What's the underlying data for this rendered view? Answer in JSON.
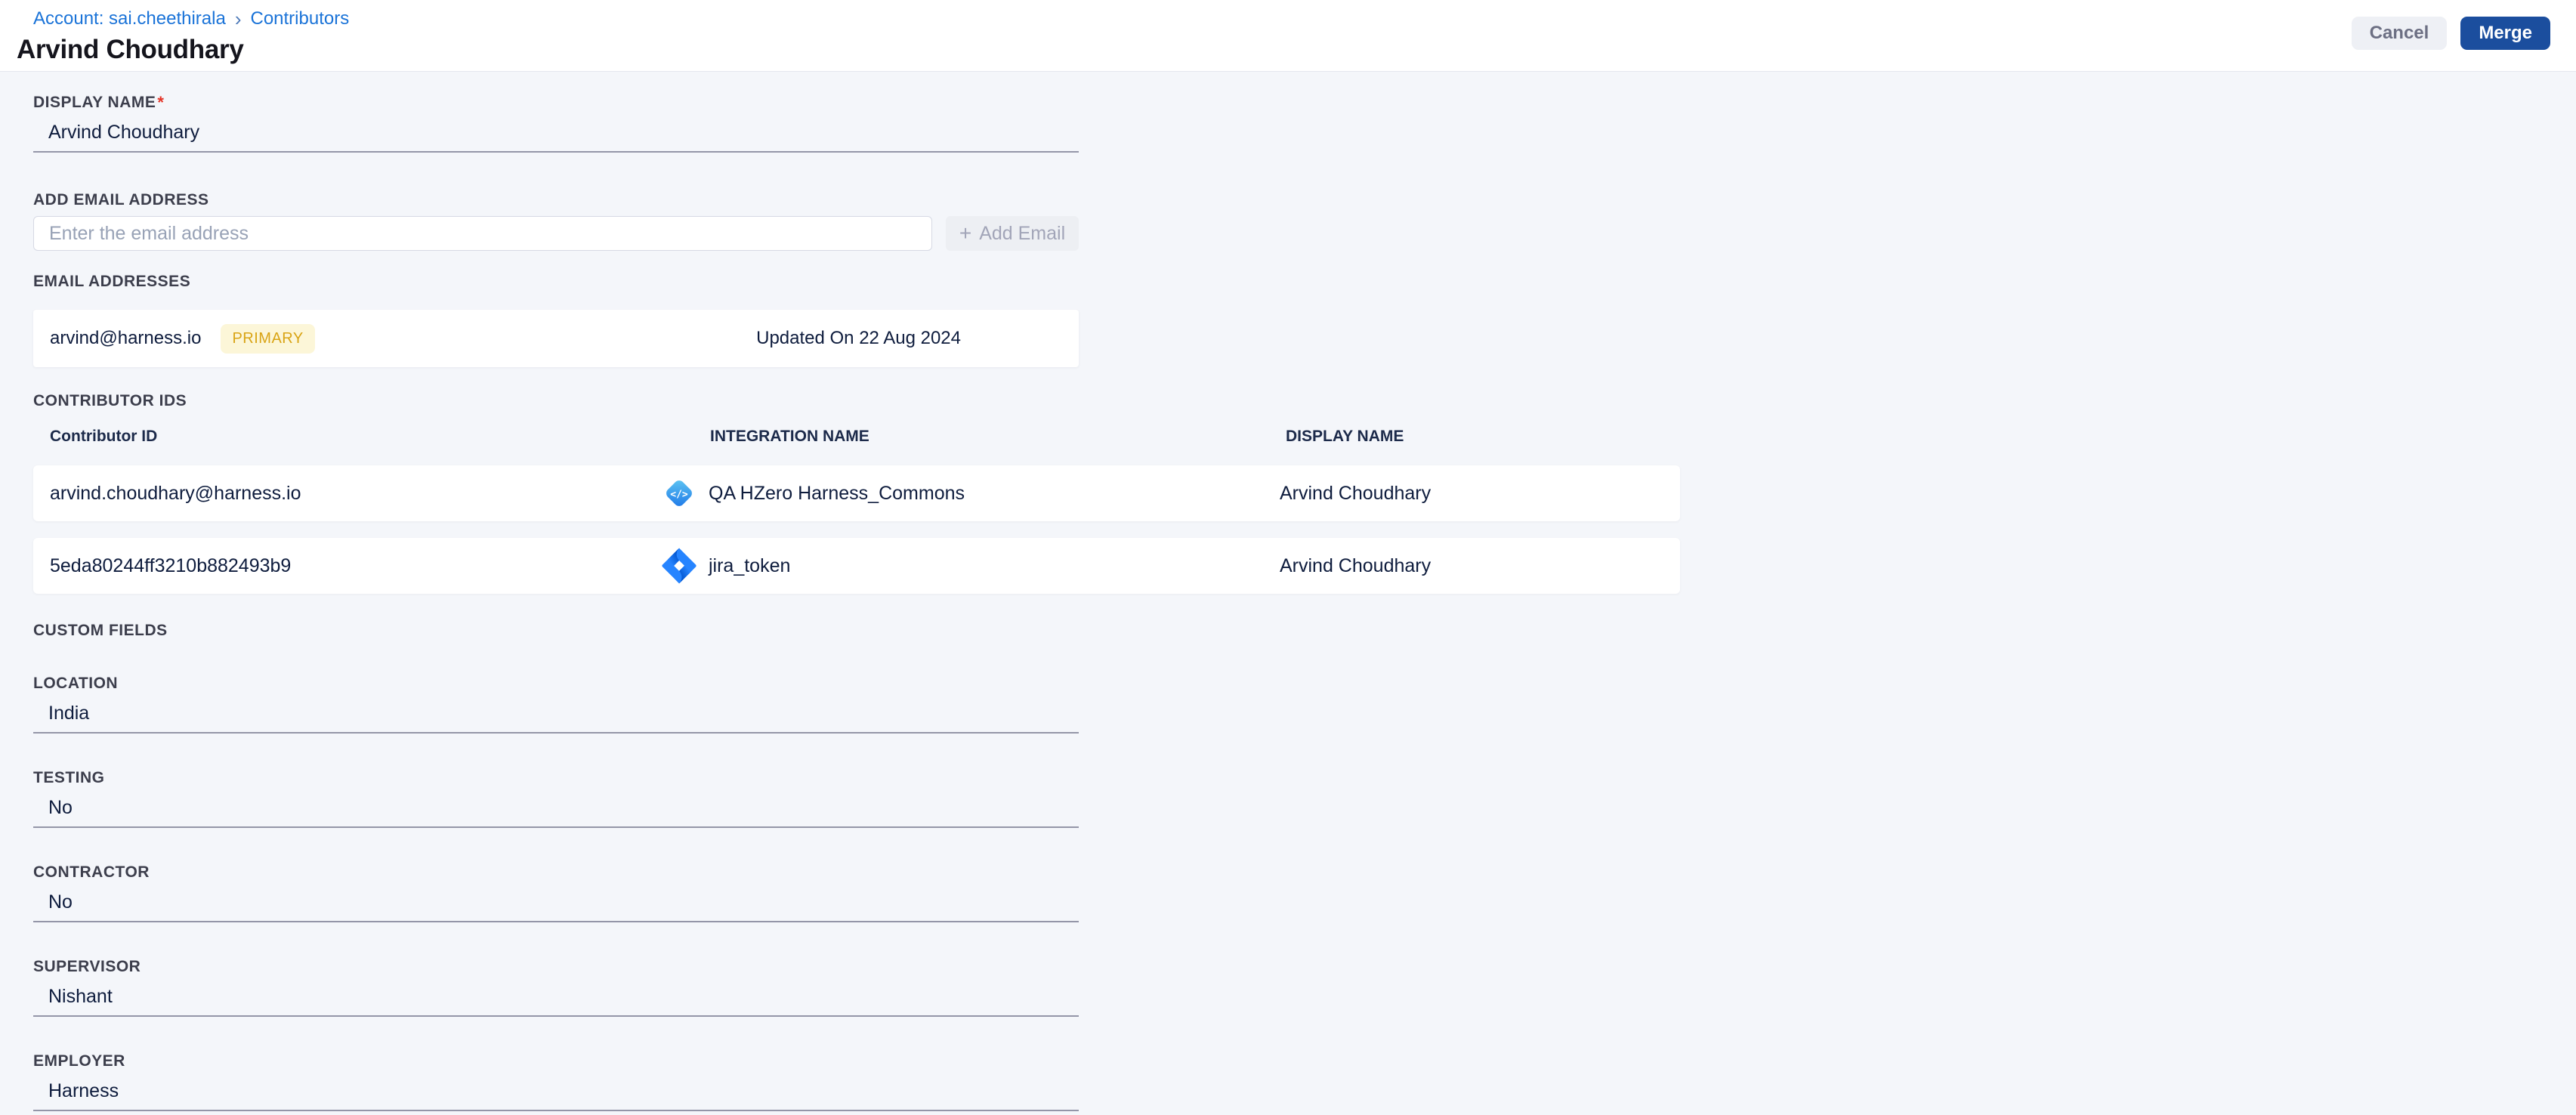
{
  "breadcrumb": {
    "account_link": "Account: sai.cheethirala",
    "separator": "›",
    "current": "Contributors"
  },
  "header": {
    "title": "Arvind Choudhary",
    "cancel_label": "Cancel",
    "merge_label": "Merge"
  },
  "display_name": {
    "label": "DISPLAY NAME",
    "required_mark": "*",
    "value": "Arvind Choudhary"
  },
  "add_email": {
    "label": "ADD EMAIL ADDRESS",
    "placeholder": "Enter the email address",
    "plus": "+",
    "button_label": "Add Email"
  },
  "email_addresses": {
    "label": "EMAIL ADDRESSES",
    "items": [
      {
        "email": "arvind@harness.io",
        "badge": "PRIMARY",
        "updated": "Updated On 22 Aug 2024"
      }
    ]
  },
  "contributor_ids": {
    "label": "CONTRIBUTOR IDS",
    "columns": [
      "Contributor ID",
      "INTEGRATION NAME",
      "DISPLAY NAME"
    ],
    "rows": [
      {
        "contributor_id": "arvind.choudhary@harness.io",
        "integration_icon": "code-integration-icon",
        "integration_name": "QA HZero Harness_Commons",
        "display_name": "Arvind Choudhary"
      },
      {
        "contributor_id": "5eda80244ff3210b882493b9",
        "integration_icon": "jira-icon",
        "integration_name": "jira_token",
        "display_name": "Arvind Choudhary"
      }
    ]
  },
  "custom_fields": {
    "label": "CUSTOM FIELDS",
    "fields": [
      {
        "label": "LOCATION",
        "value": "India"
      },
      {
        "label": "TESTING",
        "value": "No"
      },
      {
        "label": "CONTRACTOR",
        "value": "No"
      },
      {
        "label": "SUPERVISOR",
        "value": "Nishant"
      },
      {
        "label": "EMPLOYER",
        "value": "Harness"
      }
    ]
  },
  "colors": {
    "link_blue": "#1a73d8",
    "merge_button_blue": "#1b4e9e",
    "badge_bg": "#fcf6d8",
    "badge_text": "#d9a415",
    "content_bg": "#f4f6fa",
    "required_red": "#e43326"
  }
}
